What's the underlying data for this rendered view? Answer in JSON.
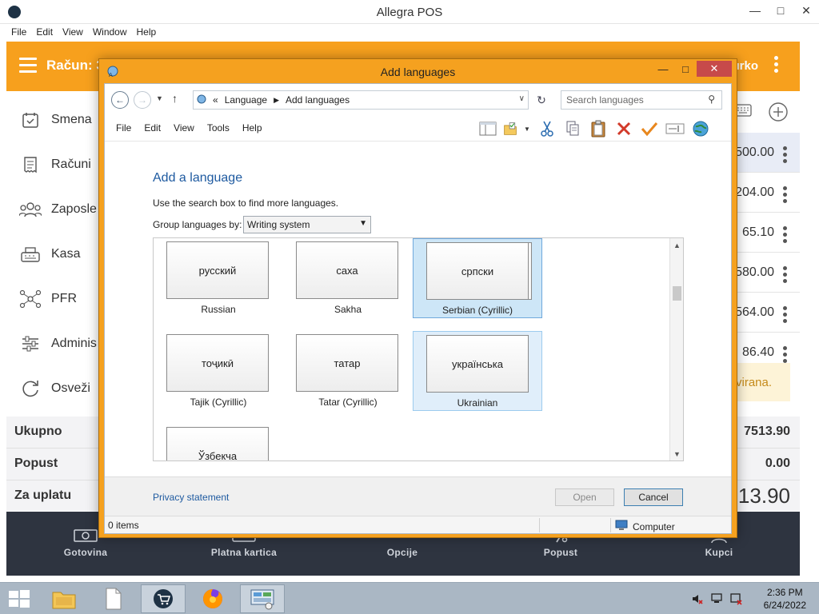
{
  "app": {
    "title": "Allegra POS",
    "menu": [
      "File",
      "Edit",
      "View",
      "Window",
      "Help"
    ],
    "header": {
      "racun_label": "Račun: 3",
      "user_label": "urko"
    },
    "sidebar": [
      {
        "label": "Smena",
        "icon": "calendar-check-icon"
      },
      {
        "label": "Računi",
        "icon": "receipt-icon"
      },
      {
        "label": "Zaposle",
        "icon": "people-icon"
      },
      {
        "label": "Kasa",
        "icon": "cash-register-icon"
      },
      {
        "label": "PFR",
        "icon": "network-icon"
      },
      {
        "label": "Adminis",
        "icon": "sliders-icon"
      },
      {
        "label": "Osveži",
        "icon": "refresh-icon"
      }
    ],
    "list_amounts": [
      "500.00",
      "204.00",
      "65.10",
      "580.00",
      "564.00",
      "86.40"
    ],
    "closed_tag": "virana.",
    "totals": {
      "ukupno_label": "Ukupno",
      "ukupno_value": "7513.90",
      "popust_label": "Popust",
      "popust_value": "0.00",
      "zauplatu_label": "Za uplatu",
      "zauplatu_value": "13.90"
    },
    "bottom_nav": [
      {
        "label": "Gotovina",
        "icon": "cash-icon"
      },
      {
        "label": "Platna kartica",
        "icon": "card-icon"
      },
      {
        "label": "Opcije",
        "icon": "options-icon"
      },
      {
        "label": "Popust",
        "icon": "percent-icon"
      },
      {
        "label": "Kupci",
        "icon": "customers-icon"
      }
    ],
    "colors": {
      "accent": "#f7a01d",
      "nav_dark": "#2e3440",
      "selected_row": "#e8ecf6"
    }
  },
  "dialog": {
    "title": "Add languages",
    "breadcrumb": {
      "prefix": "«",
      "items": [
        "Language",
        "Add languages"
      ]
    },
    "search_placeholder": "Search languages",
    "menu": [
      "File",
      "Edit",
      "View",
      "Tools",
      "Help"
    ],
    "heading": "Add a language",
    "hint": "Use the search box to find more languages.",
    "group_label": "Group languages by:",
    "group_value": "Writing system",
    "languages": [
      {
        "native": "русский",
        "name": "Russian",
        "state": "normal"
      },
      {
        "native": "саха",
        "name": "Sakha",
        "state": "normal"
      },
      {
        "native": "српски",
        "name": "Serbian (Cyrillic)",
        "state": "selected"
      },
      {
        "native": "тоҷикӣ",
        "name": "Tajik (Cyrillic)",
        "state": "normal"
      },
      {
        "native": "татар",
        "name": "Tatar (Cyrillic)",
        "state": "normal"
      },
      {
        "native": "українська",
        "name": "Ukrainian",
        "state": "hover"
      },
      {
        "native": "Ўзбекча",
        "name": "",
        "state": "normal"
      }
    ],
    "privacy_link": "Privacy statement",
    "open_label": "Open",
    "cancel_label": "Cancel",
    "status_items": "0 items",
    "status_location": "Computer"
  },
  "taskbar": {
    "time": "2:36 PM",
    "date": "6/24/2022",
    "apps": [
      "file-explorer-icon",
      "document-icon",
      "pos-cart-icon",
      "firefox-icon",
      "control-panel-icon"
    ]
  }
}
